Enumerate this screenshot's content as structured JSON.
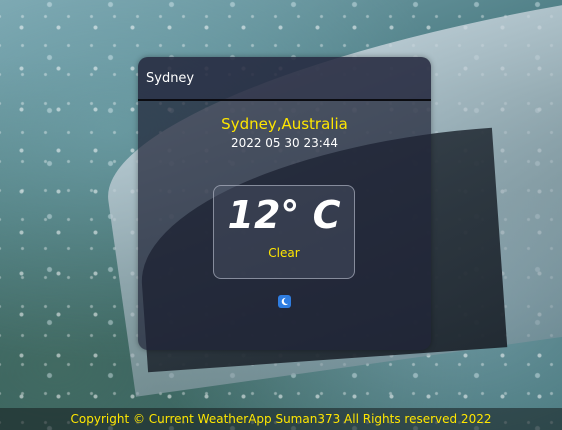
{
  "search": {
    "value": "Sydney"
  },
  "location": {
    "name": "Sydney,Australia",
    "datetime": "2022  05  30 23:44"
  },
  "weather": {
    "temperature": "12° C",
    "condition": "Clear",
    "icon": "moon-icon"
  },
  "footer": {
    "text": "Copyright © Current WeatherApp Suman373 All Rights reserved 2022"
  },
  "colors": {
    "accent": "#ffe600",
    "card": "#202438",
    "icon_bg": "#2f7de0"
  }
}
